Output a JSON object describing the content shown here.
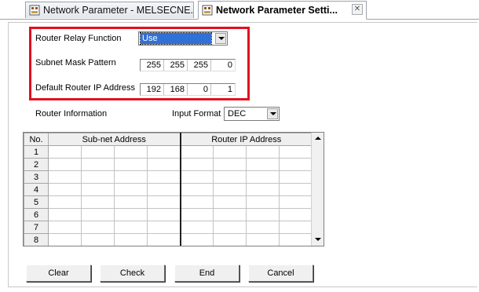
{
  "tabs": [
    {
      "label": "Network Parameter - MELSECNE...",
      "icon": "network-parameter-icon",
      "active": false
    },
    {
      "label": "Network Parameter  Setti...",
      "icon": "network-parameter-icon",
      "active": true,
      "close": "✕"
    }
  ],
  "router_relay": {
    "label": "Router Relay Function",
    "value": "Use"
  },
  "subnet_mask": {
    "label": "Subnet Mask Pattern",
    "octets": [
      "255",
      "255",
      "255",
      "0"
    ]
  },
  "default_router": {
    "label": "Default Router IP Address",
    "octets": [
      "192",
      "168",
      "0",
      "1"
    ]
  },
  "router_info": {
    "label": "Router Information",
    "input_format_label": "Input Format",
    "input_format_value": "DEC"
  },
  "table": {
    "headers": [
      "No.",
      "Sub-net Address",
      "Router IP Address"
    ],
    "rows": [
      "1",
      "2",
      "3",
      "4",
      "5",
      "6",
      "7",
      "8"
    ]
  },
  "buttons": {
    "clear": "Clear",
    "check": "Check",
    "end": "End",
    "cancel": "Cancel"
  },
  "colors": {
    "highlight_border": "#e0101e",
    "selection": "#3170d6"
  }
}
